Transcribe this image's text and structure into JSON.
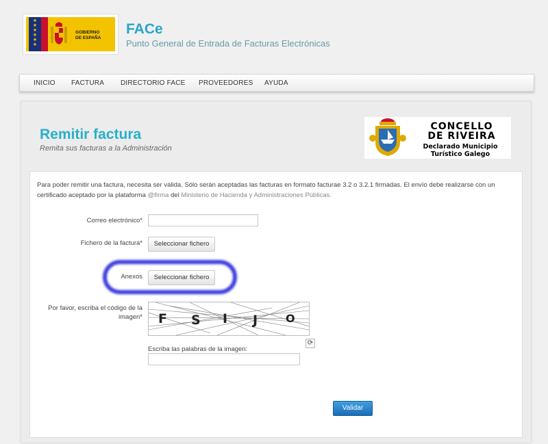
{
  "header": {
    "logo_text_line1": "GOBIERNO",
    "logo_text_line2": "DE ESPAÑA",
    "site_title": "FACe",
    "site_subtitle": "Punto General de Entrada de Facturas Electrónicas"
  },
  "nav": {
    "items": [
      {
        "label": "INICIO"
      },
      {
        "label": "FACTURA"
      },
      {
        "label": "DIRECTORIO FACE"
      },
      {
        "label": "PROVEEDORES"
      },
      {
        "label": "AYUDA"
      }
    ]
  },
  "page": {
    "title": "Remitir factura",
    "subtitle": "Remita sus facturas a la Administración"
  },
  "concello": {
    "line1": "CONCELLO",
    "line2": "DE RIVEIRA",
    "line3": "Declarado Municipio Turístico Galego"
  },
  "intro": {
    "text_part1": "Para poder remitir una factura, necesita ser válida. Sólo serán aceptadas las facturas en formato facturae 3.2 o 3.2.1 firmadas. El envío debe realizarse con un certificado aceptado por la plataforma ",
    "link1": "@firma",
    "text_part2": " del ",
    "link2": "Ministerio de Hacienda y Administraciones Públicas.",
    "text_part3": ""
  },
  "form": {
    "email_label": "Correo electrónico*",
    "email_value": "",
    "invoice_label": "Fichero de la factura*",
    "invoice_button": "Seleccionar fichero",
    "annex_label": "Anexos",
    "annex_button": "Seleccionar fichero",
    "captcha_label_line1": "Por favor, escriba el código de la",
    "captcha_label_line2": "imagen*",
    "captcha_chars": [
      "F",
      "S",
      "I",
      "J",
      "O"
    ],
    "captcha_input_label": "Escriba las palabras de la imagen:",
    "captcha_input_value": "",
    "submit_button": "Validar"
  },
  "colors": {
    "accent": "#27a6c8",
    "highlight": "#2c2cdc",
    "primary_button": "#1b6db5"
  }
}
